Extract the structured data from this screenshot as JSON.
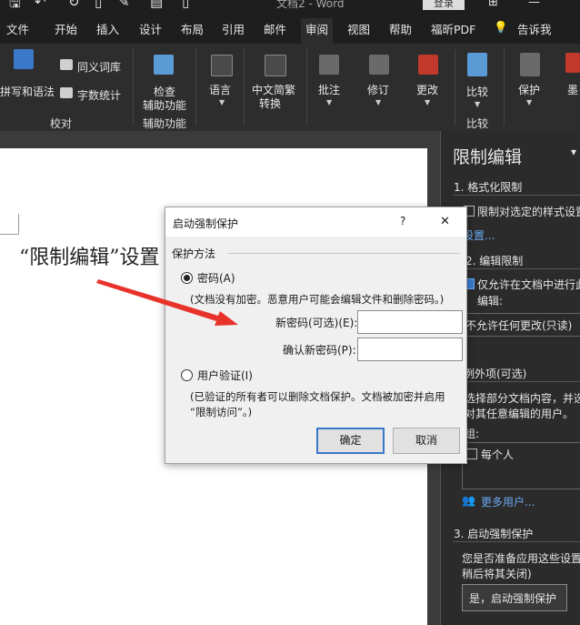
{
  "titlebar": {
    "doc_title": "文档2 - Word",
    "login": "登录"
  },
  "tabs": [
    "文件",
    "开始",
    "插入",
    "设计",
    "布局",
    "引用",
    "邮件",
    "审阅",
    "视图",
    "帮助",
    "福昕PDF",
    "告诉我"
  ],
  "ribbon": {
    "spelling": "拼写和语法",
    "thesaurus": "同义词库",
    "wordcount": "字数统计",
    "group_proofing": "校对",
    "check_access_l1": "检查",
    "check_access_l2": "辅助功能",
    "group_accessibility": "辅助功能",
    "language": "语言",
    "conv_l1": "中文简繁",
    "conv_l2": "转换",
    "comments": "批注",
    "tracking": "修订",
    "changes": "更改",
    "compare": "比较",
    "group_compare": "比较",
    "protect": "保护",
    "ink_partial": "墨"
  },
  "document": {
    "text": "“限制编辑”设置"
  },
  "pane": {
    "title": "限制编辑",
    "sec1": "1. 格式化限制",
    "sec1_check": "限制对选定的样式设置",
    "settings_link": "设置...",
    "sec2": "2. 编辑限制",
    "sec2_check": "仅允许在文档中进行此",
    "sec2_check2": "编辑:",
    "edit_mode": "不允许任何更改(只读)",
    "exceptions": "例外项(可选)",
    "exc_desc1": "选择部分文档内容，并选",
    "exc_desc2": "对其任意编辑的用户。",
    "groups_label": "组:",
    "everyone": "每个人",
    "more_users": "更多用户...",
    "sec3": "3. 启动强制保护",
    "sec3_desc1": "您是否准备应用这些设置",
    "sec3_desc2": "稍后将其关闭)",
    "start_btn": "是，启动强制保护"
  },
  "dialog": {
    "title": "启动强制保护",
    "help": "?",
    "close": "✕",
    "group": "保护方法",
    "password_radio": "密码(A)",
    "password_note": "(文档没有加密。恶意用户可能会编辑文件和删除密码。)",
    "new_pwd_label": "新密码(可选)(E):",
    "confirm_pwd_label": "确认新密码(P):",
    "new_pwd_value": "",
    "confirm_pwd_value": "",
    "user_auth_radio": "用户验证(I)",
    "user_auth_note1": "(已验证的所有者可以删除文档保护。文档被加密并启用",
    "user_auth_note2": "“限制访问”。)",
    "ok": "确定",
    "cancel": "取消"
  },
  "colors": {
    "ribbon_bg": "#2d2d2d",
    "tabbar_bg": "#1e1e1e",
    "arrow": "#e8332a",
    "accent": "#3a78c9"
  }
}
